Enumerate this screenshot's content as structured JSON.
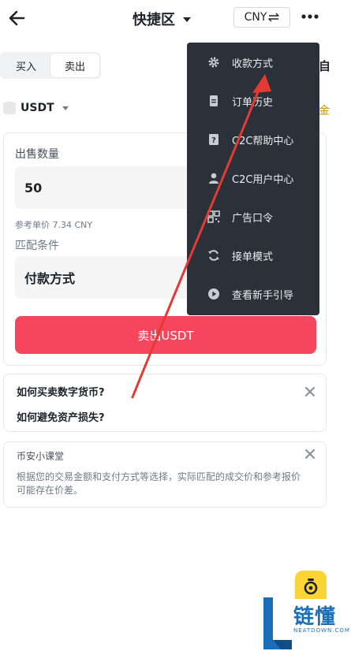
{
  "header": {
    "title": "快捷区",
    "currency": "CNY"
  },
  "tabs": [
    {
      "label": "买入",
      "active": false
    },
    {
      "label": "卖出",
      "active": true
    }
  ],
  "right_peek": {
    "top_char": "自",
    "gold_char": "金"
  },
  "coin_selector": {
    "label": "USDT"
  },
  "sell_form": {
    "amount_label": "出售数量",
    "amount_value": "50",
    "ref_price": "参考单价 7.34 CNY",
    "match_label": "匹配条件",
    "payment_label": "付款方式",
    "submit_label": "卖出USDT"
  },
  "faq": {
    "q1": "如何买卖数字货币?",
    "q2": "如何避免资产损失?"
  },
  "tips": {
    "title": "币安小课堂",
    "body": "根据您的交易金额和支付方式等选择，实际匹配的成交价和参考报价可能存在价差。"
  },
  "menu": {
    "items": [
      {
        "label": "收款方式",
        "icon": "gear-icon"
      },
      {
        "label": "订单历史",
        "icon": "document-icon"
      },
      {
        "label": "C2C帮助中心",
        "icon": "help-book-icon"
      },
      {
        "label": "C2C用户中心",
        "icon": "user-icon"
      },
      {
        "label": "广告口令",
        "icon": "qr-code-icon"
      },
      {
        "label": "接单模式",
        "icon": "refresh-icon"
      },
      {
        "label": "查看新手引导",
        "icon": "play-icon"
      }
    ]
  },
  "watermark": {
    "brand": "链懂",
    "site": "NEATDOWN.COM"
  },
  "colors": {
    "accent_sell": "#f6465d",
    "menu_bg": "#2b3139",
    "annotation_arrow": "#e53935",
    "brand_yellow": "#fcd535"
  }
}
